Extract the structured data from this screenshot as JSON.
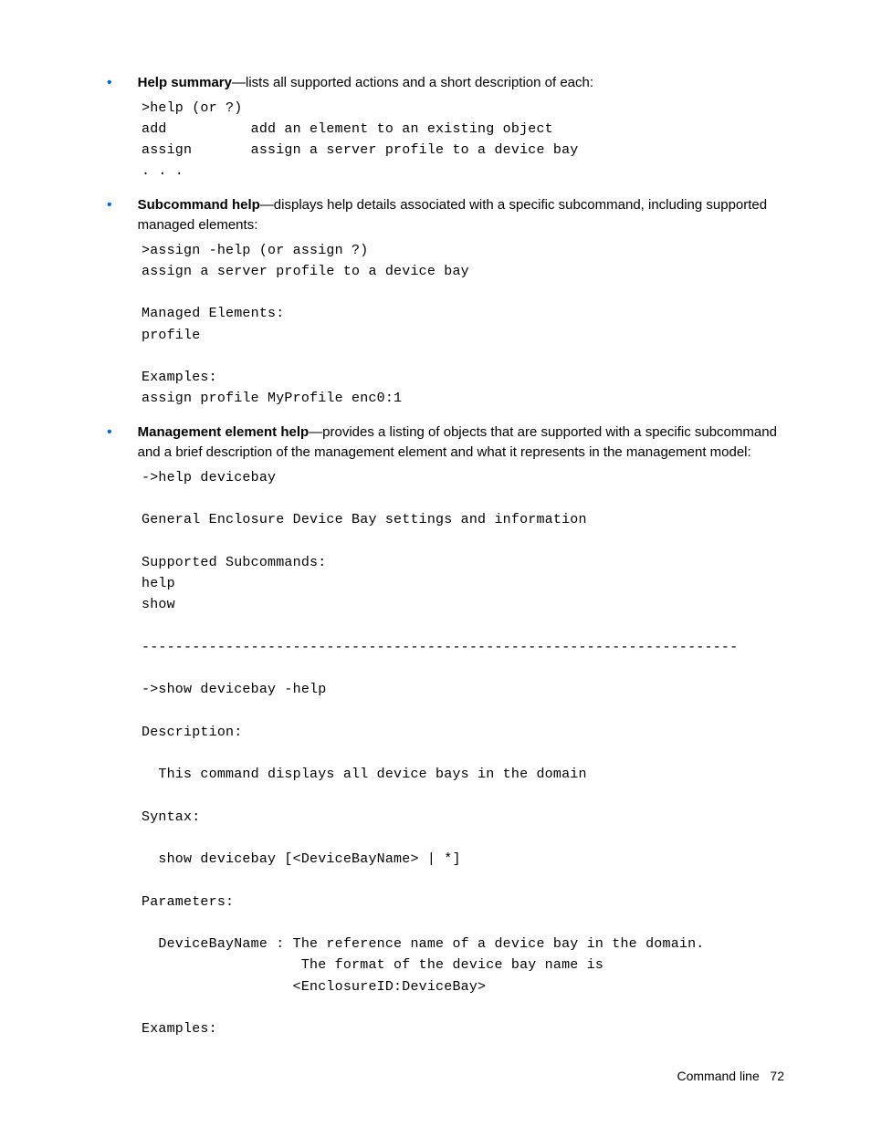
{
  "sections": [
    {
      "heading_bold": "Help summary",
      "heading_rest": "—lists all supported actions and a short description of each:",
      "code": ">help (or ?)\nadd          add an element to an existing object\nassign       assign a server profile to a device bay\n. . ."
    },
    {
      "heading_bold": "Subcommand help",
      "heading_rest": "—displays help details associated with a specific subcommand, including supported managed elements:",
      "code": ">assign -help (or assign ?)\nassign a server profile to a device bay\n\nManaged Elements:\nprofile\n\nExamples:\nassign profile MyProfile enc0:1"
    },
    {
      "heading_bold": "Management element help",
      "heading_rest": "—provides a listing of objects that are supported with a specific subcommand and a brief description of the management element and what it represents in the management model:",
      "code": "->help devicebay\n\nGeneral Enclosure Device Bay settings and information\n\nSupported Subcommands:\nhelp\nshow\n\n-----------------------------------------------------------------------\n\n->show devicebay -help\n\nDescription:\n\n  This command displays all device bays in the domain\n\nSyntax:\n\n  show devicebay [<DeviceBayName> | *]\n\nParameters:\n\n  DeviceBayName : The reference name of a device bay in the domain.\n                   The format of the device bay name is\n                  <EnclosureID:DeviceBay>\n\nExamples:"
    }
  ],
  "footer": {
    "label": "Command line",
    "page": "72"
  }
}
